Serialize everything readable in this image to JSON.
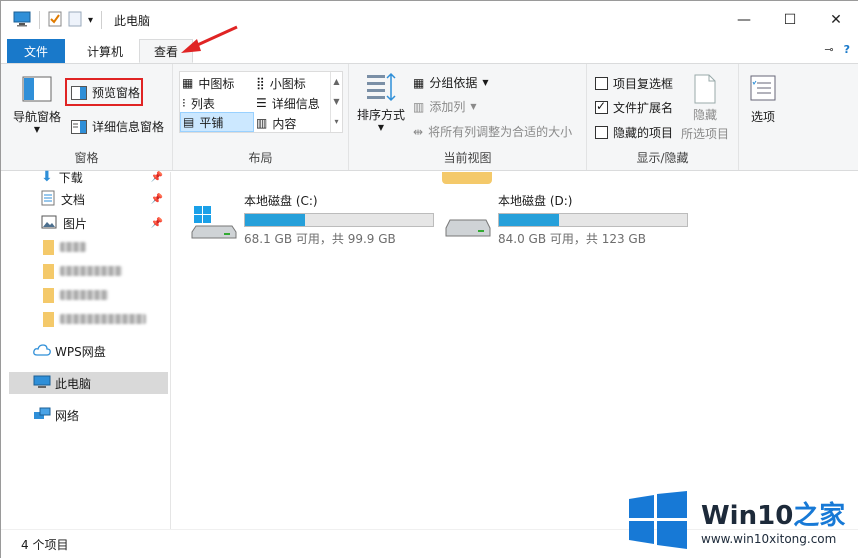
{
  "window": {
    "title": "此电脑",
    "controls": {
      "minimize": "—",
      "maximize": "☐",
      "close": "✕"
    }
  },
  "tabs": [
    {
      "label": "文件"
    },
    {
      "label": "计算机"
    },
    {
      "label": "查看"
    }
  ],
  "ribbon": {
    "panes": {
      "label": "窗格",
      "nav_pane": "导航窗格",
      "preview_pane": "预览窗格",
      "details_pane": "详细信息窗格"
    },
    "layout": {
      "label": "布局",
      "items": [
        "中图标",
        "小图标",
        "列表",
        "详细信息",
        "平铺",
        "内容"
      ]
    },
    "current_view": {
      "label": "当前视图",
      "sort_by": "排序方式",
      "group_by": "分组依据",
      "add_columns": "添加列",
      "size_all_columns": "将所有列调整为合适的大小"
    },
    "show_hide": {
      "label": "显示/隐藏",
      "item_checkboxes": "项目复选框",
      "file_extensions": "文件扩展名",
      "hidden_items": "隐藏的项目",
      "hide_selected_1": "隐藏",
      "hide_selected_2": "所选项目",
      "file_extensions_checked": true
    },
    "options": {
      "label": "选项"
    }
  },
  "nav": {
    "items": [
      {
        "label": "下载"
      },
      {
        "label": "文档"
      },
      {
        "label": "图片"
      },
      {
        "label": "WPS网盘"
      },
      {
        "label": "此电脑"
      },
      {
        "label": "网络"
      }
    ]
  },
  "drives": [
    {
      "name": "本地磁盘 (C:)",
      "space": "68.1 GB 可用，共 99.9 GB",
      "used_fraction": 0.318
    },
    {
      "name": "本地磁盘 (D:)",
      "space": "84.0 GB 可用，共 123 GB",
      "used_fraction": 0.317
    }
  ],
  "status": {
    "item_count": "4 个项目"
  },
  "watermark": {
    "brand_a": "Win10",
    "brand_b": "之家",
    "url": "www.win10xitong.com"
  },
  "colors": {
    "accent": "#1979ca",
    "drive_fill": "#26a0da",
    "highlight": "#e02424"
  }
}
